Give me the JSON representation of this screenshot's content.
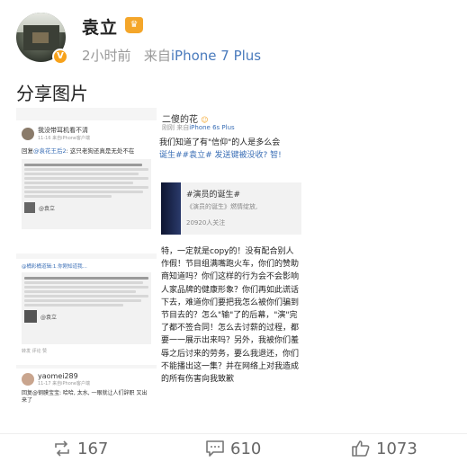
{
  "post": {
    "author": "袁立",
    "time": "2小时前",
    "from_prefix": "来自",
    "device": "iPhone 7 Plus",
    "text": "分享图片"
  },
  "left_image": {
    "card1": {
      "user": "我没带耳机看不清",
      "meta": "11-16 来自iPhone客户端",
      "reply_prefix": "回复",
      "reply_user": "@袁花王后2",
      "reply_text": ": 这只老狗还真是无处不在",
      "bottom_tag": "@袁立"
    },
    "card2": {
      "top_line": "@桶彩桶道辑:1.你刚知道我...",
      "tag": "@袁立",
      "bottom": "转发 评论 赞"
    },
    "card3": {
      "user": "yaomei289",
      "meta": "11-17 来自iPhone客户端",
      "text": "回复@钢膜宝宝: 哈哈, 太水, 一眼就让人们辞职 又出来了"
    }
  },
  "right_image": {
    "user": "二傻的花",
    "meta_prefix": "刚刚 来自",
    "meta_device": "iPhone 6s Plus",
    "question_lines": [
      "我们知道了有\"信仰\"的人是多么会",
      "诞生##袁立# 发送键被没收? 智!"
    ],
    "topic": {
      "title": "#演员的诞生#",
      "subtitle": "《演员的诞生》燃情绽放,",
      "count": "20920人关注"
    },
    "body": "特，一定就是copy的！没有配合别人作假！节目组满嘴跑火车，你们的赞助商知道吗？你们这样的行为会不会影响人家品牌的健康形象？你们再如此谎话下去，难道你们要把我怎么被你们骗到节目去的？怎么\"输\"了的后幕，\"演\"完了都不签合同！怎么去讨薪的过程，都要一一展示出来吗？另外，我被你们羞辱之后讨来的劳务，要么我退还，你们不能播出这一集？并在网络上对我造成的所有伤害向我致歉"
  },
  "actions": {
    "repost_count": "167",
    "comment_count": "610",
    "like_count": "1073"
  }
}
